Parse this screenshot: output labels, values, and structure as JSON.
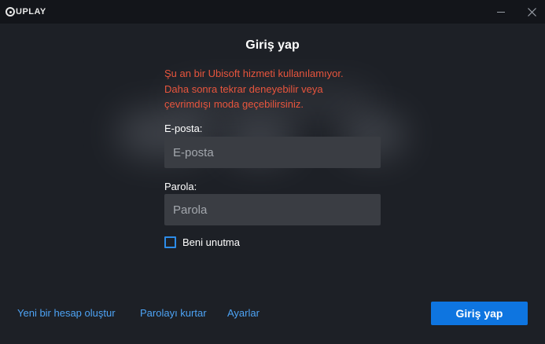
{
  "titlebar": {
    "logo_text": "UPLAY",
    "minimize_icon": "minimize-icon",
    "close_icon": "close-icon"
  },
  "main": {
    "title": "Giriş yap",
    "error_lines": [
      "Şu an bir Ubisoft hizmeti kullanılamıyor.",
      "Daha sonra tekrar deneyebilir veya",
      "çevrimdışı moda geçebilirsiniz."
    ],
    "email": {
      "label": "E-posta:",
      "placeholder": "E-posta",
      "value": ""
    },
    "password": {
      "label": "Parola:",
      "placeholder": "Parola",
      "value": ""
    },
    "remember": {
      "label": "Beni unutma",
      "checked": false
    }
  },
  "footer": {
    "links": [
      "Yeni bir hesap oluştur",
      "Parolayı kurtar",
      "Ayarlar"
    ],
    "login_button": "Giriş yap"
  },
  "colors": {
    "background": "#1d2026",
    "titlebar": "#13151a",
    "error": "#e8553d",
    "link": "#4da3f5",
    "primary_button": "#0e75e0",
    "input_background": "#3a3d43",
    "checkbox_border": "#2d8ce8"
  }
}
